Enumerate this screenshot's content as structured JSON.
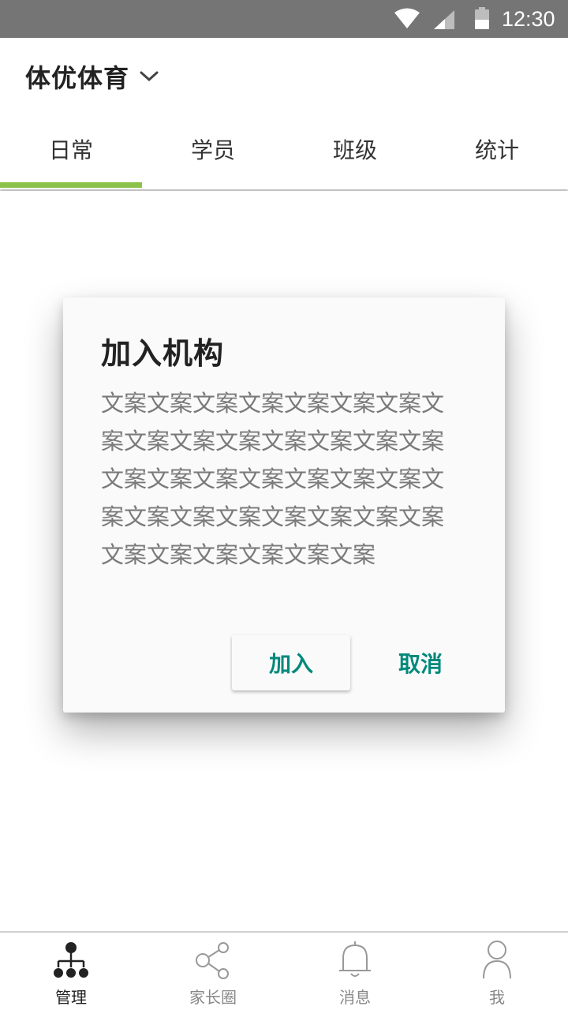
{
  "status_bar": {
    "time": "12:30",
    "icons": [
      "wifi-icon",
      "cell-signal-icon",
      "battery-icon"
    ]
  },
  "header": {
    "org_name": "体优体育",
    "dropdown_icon": "chevron-down-icon"
  },
  "tabs": [
    {
      "label": "日常",
      "active": true
    },
    {
      "label": "学员",
      "active": false
    },
    {
      "label": "班级",
      "active": false
    },
    {
      "label": "统计",
      "active": false
    }
  ],
  "dialog": {
    "title": "加入机构",
    "message": "文案文案文案文案文案文案文案文案文案文案文案文案文案文案文案文案文案文案文案文案文案文案文案文案文案文案文案文案文案文案文案文案文案文案文案文案",
    "confirm_label": "加入",
    "cancel_label": "取消"
  },
  "bottom_nav": [
    {
      "label": "管理",
      "icon": "org-chart-icon",
      "active": true
    },
    {
      "label": "家长圈",
      "icon": "share-icon",
      "active": false
    },
    {
      "label": "消息",
      "icon": "bell-icon",
      "active": false
    },
    {
      "label": "我",
      "icon": "person-icon",
      "active": false
    }
  ],
  "colors": {
    "status_bar": "#757575",
    "tab_indicator": "#8bc34a",
    "dialog_button_text": "#00897b",
    "nav_active": "#222222",
    "nav_inactive": "#888888"
  }
}
